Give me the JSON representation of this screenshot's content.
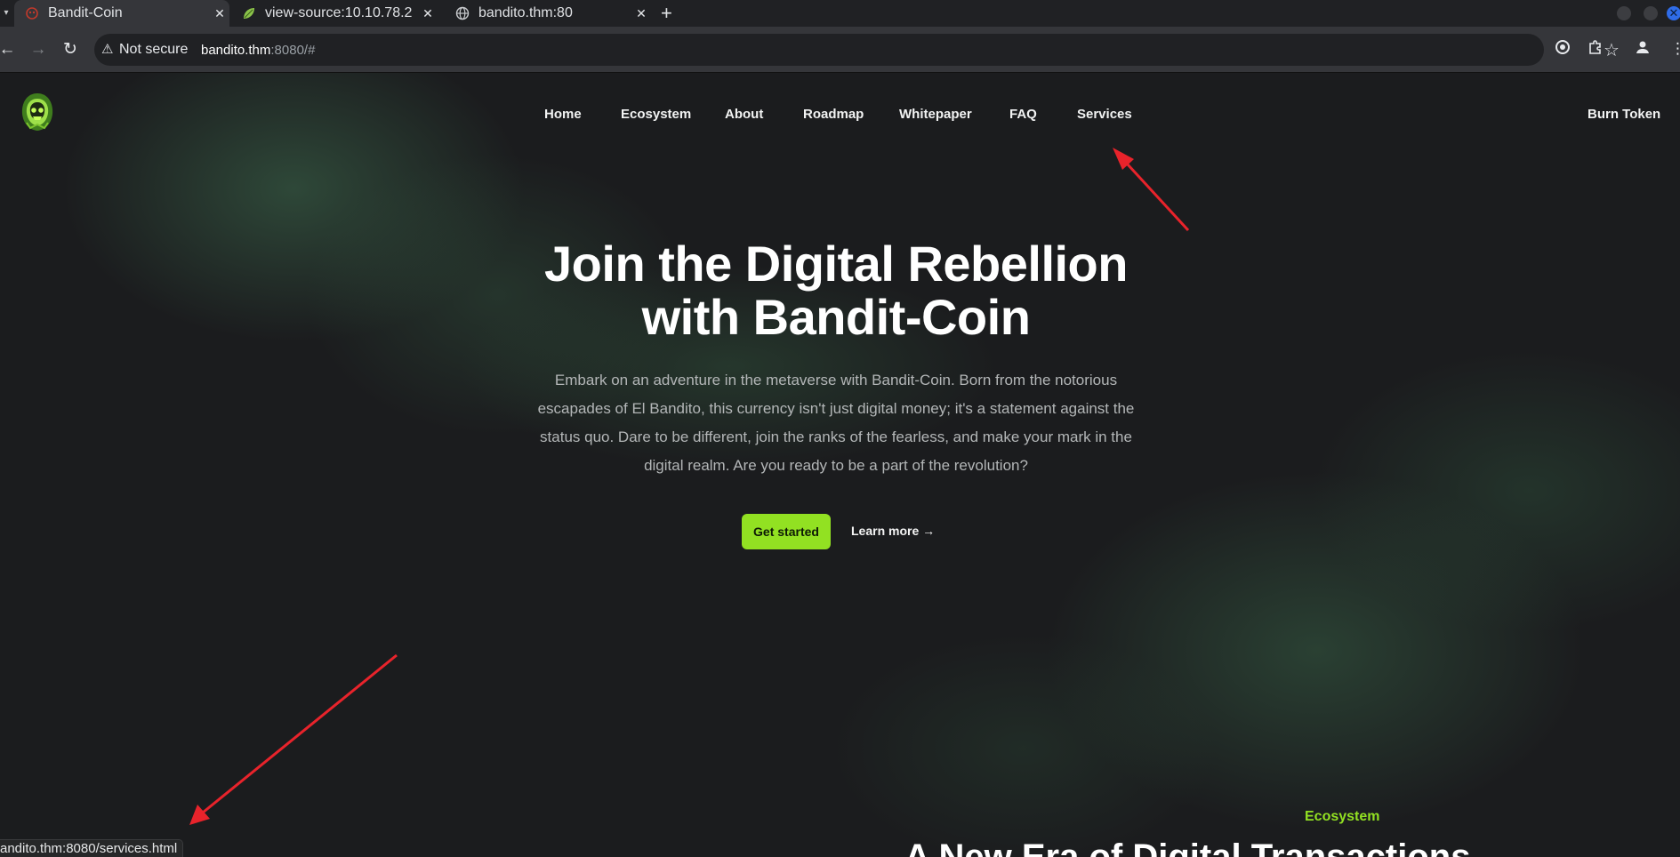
{
  "browser": {
    "tabs": [
      {
        "title": "Bandit-Coin",
        "active": true,
        "icon": "bandit-favicon"
      },
      {
        "title": "view-source:10.10.78.2",
        "active": false,
        "icon": "leaf-favicon"
      },
      {
        "title": "bandito.thm:80",
        "active": false,
        "icon": "globe-favicon"
      }
    ],
    "security_label": "Not secure",
    "url_host": "bandito.thm",
    "url_rest": ":8080/#",
    "status_url": "andito.thm:8080/services.html"
  },
  "site": {
    "nav": [
      "Home",
      "Ecosystem",
      "About",
      "Roadmap",
      "Whitepaper",
      "FAQ",
      "Services"
    ],
    "burn_token": "Burn Token",
    "hero": {
      "title_line1": "Join the Digital Rebellion",
      "title_line2": "with Bandit-Coin",
      "subtitle": "Embark on an adventure in the metaverse with Bandit-Coin. Born from the notorious escapades of El Bandito, this currency isn't just digital money; it's a statement against the status quo. Dare to be different, join the ranks of the fearless, and make your mark in the digital realm. Are you ready to be a part of the revolution?",
      "cta_primary": "Get started",
      "cta_secondary": "Learn more →"
    },
    "ecosystem": {
      "label": "Ecosystem",
      "title": "A New Era of Digital Transactions"
    }
  },
  "colors": {
    "accent": "#92e122",
    "background": "#1b1c1e",
    "annotation": "#e8232b"
  }
}
